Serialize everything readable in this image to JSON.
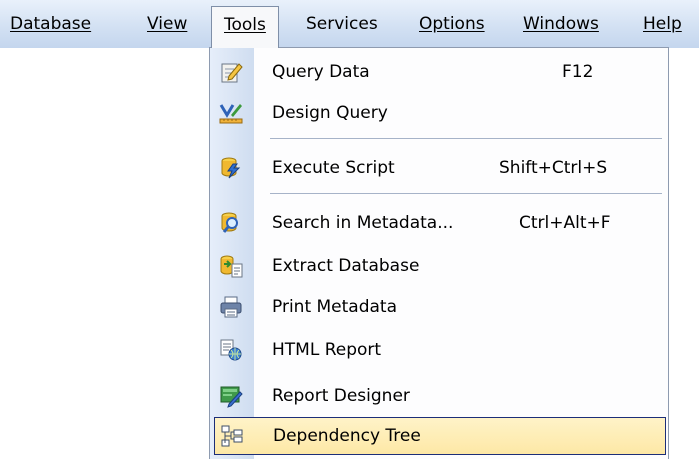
{
  "menubar": {
    "items": [
      {
        "label": "Database"
      },
      {
        "label": "View"
      },
      {
        "label": "Tools"
      },
      {
        "label": "Services"
      },
      {
        "label": "Options"
      },
      {
        "label": "Windows"
      },
      {
        "label": "Help"
      }
    ]
  },
  "tools_menu": {
    "items": [
      {
        "label": "Query Data",
        "shortcut": "F12",
        "icon": "query-data-icon"
      },
      {
        "label": "Design Query",
        "shortcut": "",
        "icon": "design-query-icon"
      },
      {
        "label": "Execute Script",
        "shortcut": "Shift+Ctrl+S",
        "icon": "execute-script-icon"
      },
      {
        "label": "Search in Metadata...",
        "shortcut": "Ctrl+Alt+F",
        "icon": "search-metadata-icon"
      },
      {
        "label": "Extract Database",
        "shortcut": "",
        "icon": "extract-database-icon"
      },
      {
        "label": "Print Metadata",
        "shortcut": "",
        "icon": "printer-icon"
      },
      {
        "label": "HTML Report",
        "shortcut": "",
        "icon": "html-report-icon"
      },
      {
        "label": "Report Designer",
        "shortcut": "",
        "icon": "report-designer-icon"
      },
      {
        "label": "Dependency Tree",
        "shortcut": "",
        "icon": "dependency-tree-icon"
      }
    ],
    "highlighted_item": "Dependency Tree"
  },
  "colors": {
    "menubar_bg": "#d3e1f3",
    "highlight_bg": "#fde8a6",
    "highlight_border": "#1c2e78"
  }
}
